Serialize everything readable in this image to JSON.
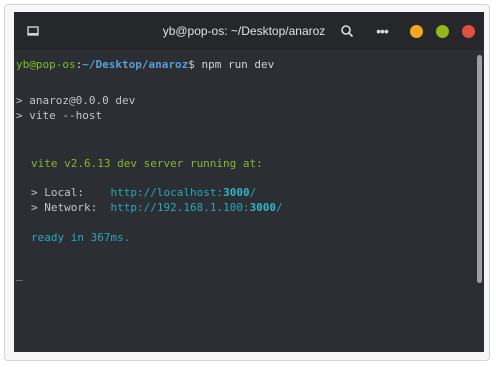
{
  "window": {
    "title": "yb@pop-os: ~/Desktop/anaroz",
    "icons": [
      "new-tab-icon",
      "search-icon",
      "menu-icon"
    ],
    "controls": {
      "minimize_color": "#f6a81c",
      "maximize_color": "#94b51f",
      "close_color": "#e0503f"
    }
  },
  "terminal": {
    "prompt_user": "yb@pop-os",
    "prompt_sep": ":",
    "prompt_path": "~/Desktop/anaroz",
    "prompt_symbol": "$",
    "command": " npm run dev",
    "out1": "> anaroz@0.0.0 dev",
    "out2": "> vite --host",
    "vite_banner": "vite v2.6.13 dev server running at:",
    "local_label": "> Local:    ",
    "local_url_prefix": "http://localhost:",
    "local_port": "3000",
    "local_url_suffix": "/",
    "network_label": "> Network:  ",
    "network_url_prefix": "http://192.168.1.100:",
    "network_port": "3000",
    "network_url_suffix": "/",
    "ready": "ready in 367ms.",
    "cursor": "_"
  }
}
